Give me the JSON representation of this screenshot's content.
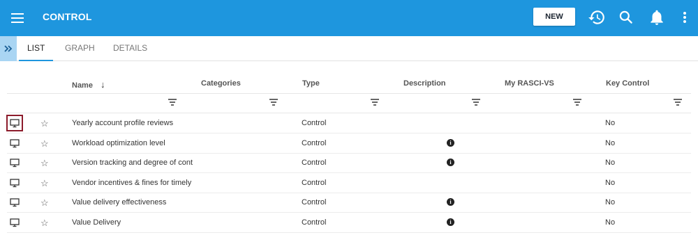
{
  "app": {
    "title": "CONTROL",
    "new_label": "NEW"
  },
  "icons": {
    "menu": "hamburger-icon",
    "history": "history-icon",
    "search": "search-icon",
    "notifications": "bell-icon",
    "more": "more-vertical-icon"
  },
  "tabs": [
    {
      "label": "LIST",
      "active": true
    },
    {
      "label": "GRAPH"
    },
    {
      "label": "DETAILS"
    }
  ],
  "table": {
    "columns": [
      "Name",
      "Categories",
      "Type",
      "Description",
      "My RASCI-VS",
      "Key Control"
    ],
    "sort_indicator": "↓",
    "rows": [
      {
        "name": "Yearly account profile reviews",
        "type": "Control",
        "has_description": false,
        "key_control": "No",
        "selected": true
      },
      {
        "name": "Workload optimization level",
        "type": "Control",
        "has_description": true,
        "key_control": "No"
      },
      {
        "name": "Version tracking and degree of cont",
        "type": "Control",
        "has_description": true,
        "key_control": "No"
      },
      {
        "name": "Vendor incentives & fines for timely",
        "type": "Control",
        "has_description": false,
        "key_control": "No"
      },
      {
        "name": "Value delivery effectiveness",
        "type": "Control",
        "has_description": true,
        "key_control": "No"
      },
      {
        "name": "Value Delivery",
        "type": "Control",
        "has_description": true,
        "key_control": "No"
      }
    ]
  },
  "colors": {
    "header": "#1e96de",
    "selection_border": "#8c1b2b",
    "expand_bg": "#a9d5f3"
  }
}
